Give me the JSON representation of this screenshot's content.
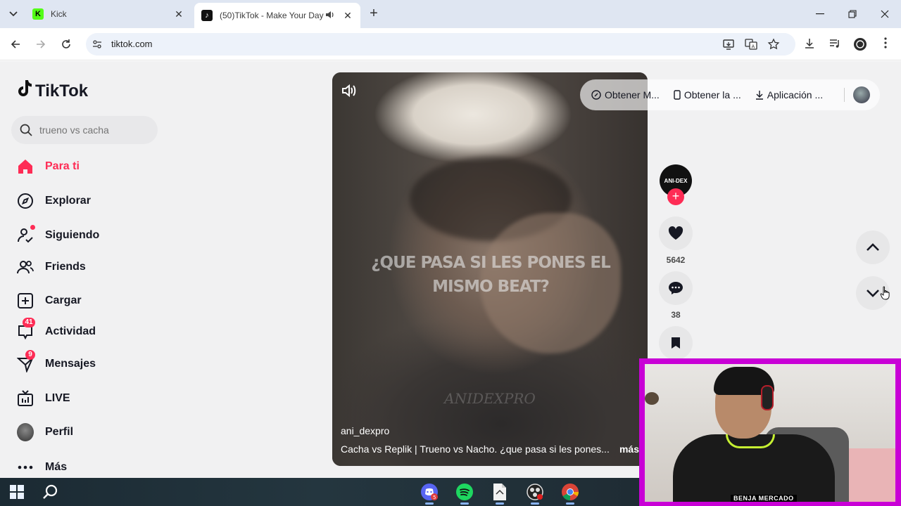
{
  "browser": {
    "tabs": [
      {
        "title": "Kick",
        "active": false
      },
      {
        "title": "(50)TikTok - Make Your Day",
        "active": true
      }
    ],
    "url": "tiktok.com"
  },
  "tiktok": {
    "logo": "TikTok",
    "search_placeholder": "trueno vs cacha",
    "nav": [
      {
        "label": "Para ti",
        "active": true
      },
      {
        "label": "Explorar"
      },
      {
        "label": "Siguiendo"
      },
      {
        "label": "Friends"
      },
      {
        "label": "Cargar"
      },
      {
        "label": "Actividad",
        "badge": "41"
      },
      {
        "label": "Mensajes",
        "badge": "9"
      },
      {
        "label": "LIVE"
      },
      {
        "label": "Perfil"
      },
      {
        "label": "Más"
      }
    ],
    "top_links": [
      "Obtener M...",
      "Obtener la ...",
      "Aplicación ..."
    ],
    "video": {
      "overlay_text": "¿QUE PASA SI LES PONES EL MISMO BEAT?",
      "watermark": "ANIDEXPRO",
      "author": "ani_dexpro",
      "description": "Cacha vs Replik | Trueno vs Nacho. ¿que pasa si les pones...",
      "more": "más"
    },
    "creator_avatar_text": "ANI-DEX",
    "likes": "5642",
    "comments": "38"
  },
  "webcam": {
    "name": "BENJA MERCADO"
  },
  "colors": {
    "accent": "#fe2c55",
    "cam_border": "#c800d6"
  }
}
